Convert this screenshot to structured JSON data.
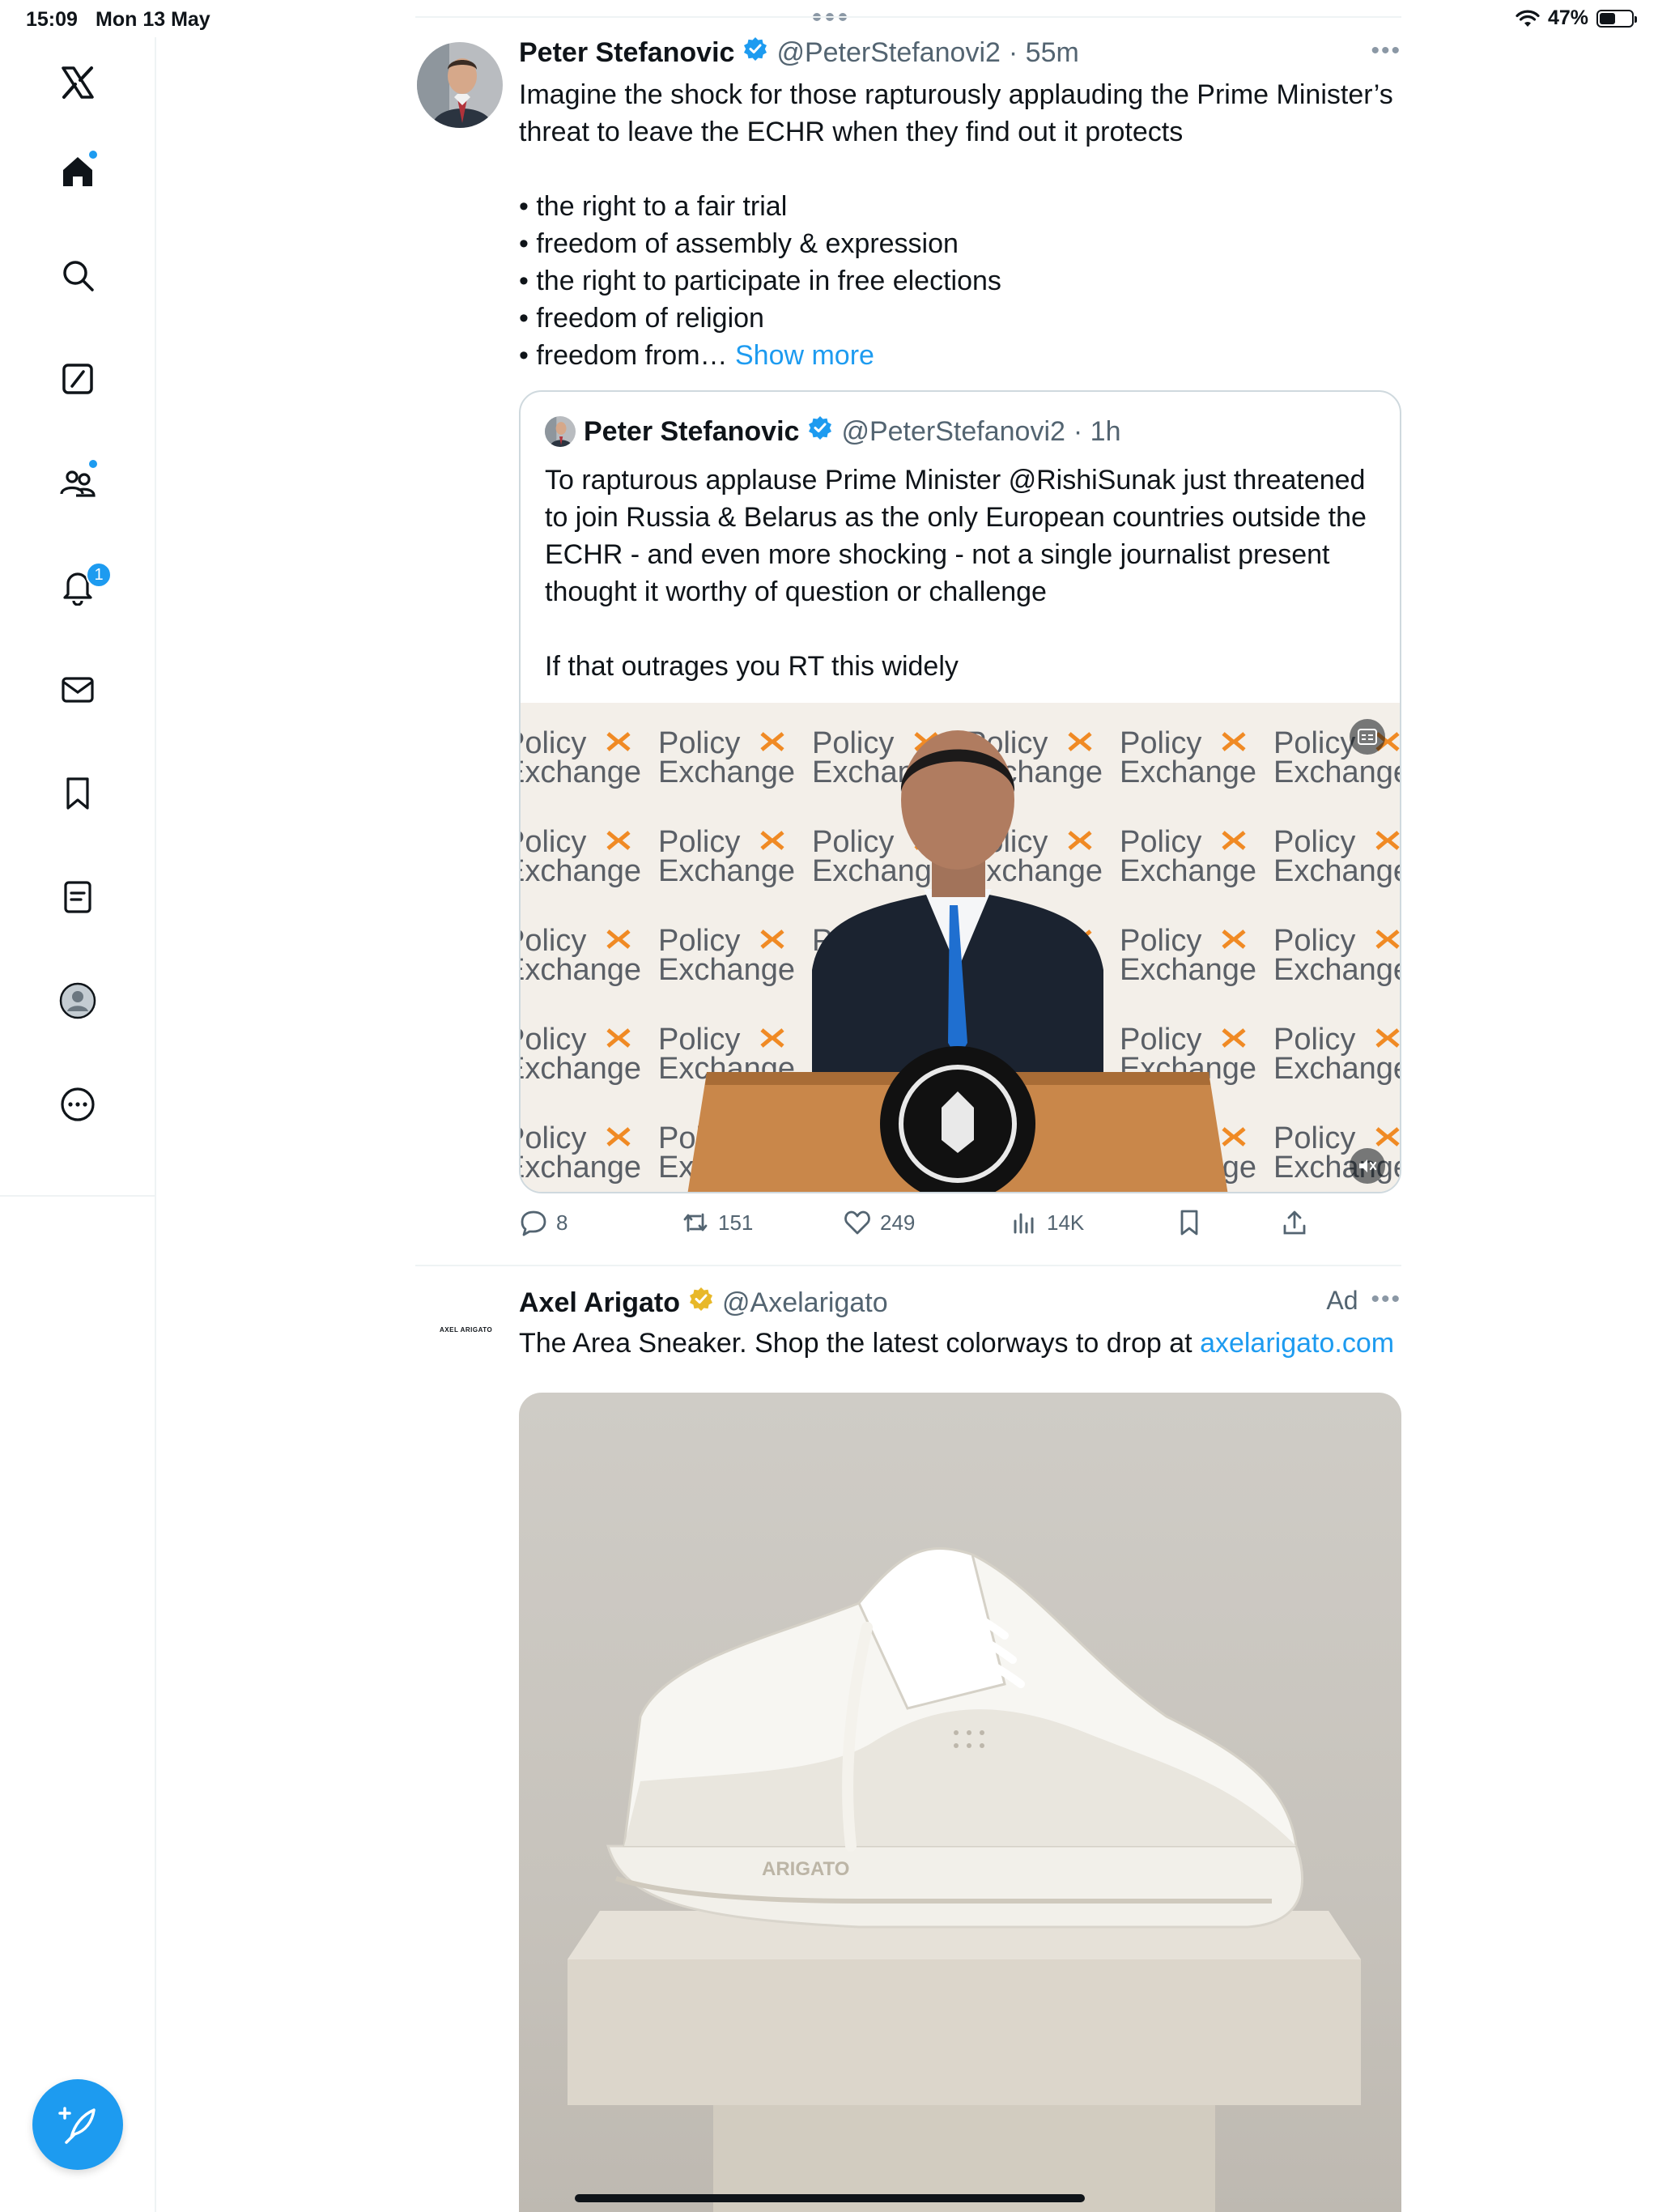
{
  "status_bar": {
    "time": "15:09",
    "date": "Mon 13 May",
    "battery": "47%"
  },
  "sidebar": {
    "items": [
      {
        "name": "x-logo"
      },
      {
        "name": "home"
      },
      {
        "name": "explore"
      },
      {
        "name": "grok"
      },
      {
        "name": "communities"
      },
      {
        "name": "notifications",
        "badge": "1"
      },
      {
        "name": "messages"
      },
      {
        "name": "bookmarks"
      },
      {
        "name": "lists"
      },
      {
        "name": "profile"
      },
      {
        "name": "more"
      }
    ]
  },
  "tweet": {
    "name": "Peter Stefanovic",
    "handle": "@PeterStefanovi2",
    "time": "· 55m",
    "text": "Imagine the shock for those rapturously applauding the Prime Minister’s threat to leave the ECHR when they find out it protects\n\n• the right to a fair trial\n• freedom of assembly & expression\n• the right to participate in free elections\n• freedom of religion\n• freedom from… ",
    "show_more": "Show more",
    "quote": {
      "name": "Peter Stefanovic",
      "handle": "@PeterStefanovi2",
      "time": "· 1h",
      "text": "To rapturous applause Prime Minister @RishiSunak just threatened to join Russia & Belarus as the only European countries outside the ECHR - and even more shocking - not a single journalist present thought it worthy of question or challenge\n\nIf that outrages you RT this widely",
      "media_backdrop_text": [
        "Policy",
        "Exchange"
      ]
    },
    "actions": {
      "replies": "8",
      "reposts": "151",
      "likes": "249",
      "views": "14K"
    }
  },
  "ad": {
    "name": "Axel Arigato",
    "handle": "@Axelarigato",
    "label": "Ad",
    "text": "The Area Sneaker. Shop the latest colorways to drop at ",
    "link": "axelarigato.com",
    "logo_text": "AXEL ARIGATO",
    "shoe_brand": "ARIGATO"
  },
  "colors": {
    "accent": "#1d9bf0",
    "gold_badge": "#e8b829",
    "text": "#0f1419",
    "muted": "#536471"
  }
}
